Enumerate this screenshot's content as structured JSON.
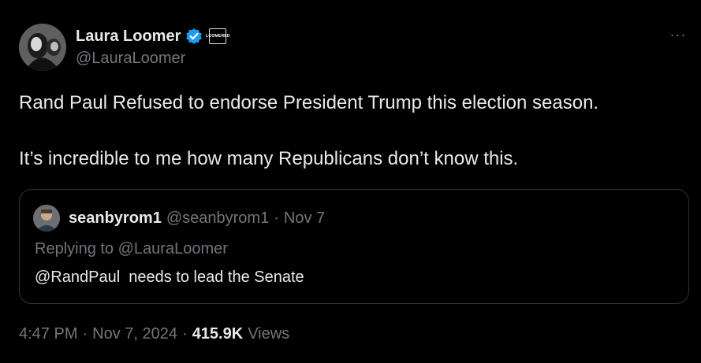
{
  "author": {
    "display_name": "Laura Loomer",
    "handle": "@LauraLoomer",
    "verified_icon": "verified-badge-icon",
    "affiliation_icon": "affiliation-badge-icon",
    "affiliation_badge_text": "LOOMERED",
    "accent_color": "#1d9bf0"
  },
  "menu": {
    "more_label": "···"
  },
  "tweet": {
    "line1": "Rand Paul Refused to endorse President Trump this election season.",
    "line2": "It’s incredible to me how many Republicans don’t know this."
  },
  "quote": {
    "display_name": "seanbyrom1",
    "handle": "@seanbyrom1",
    "separator": "·",
    "date": "Nov 7",
    "replying_prefix": "Replying to",
    "replying_handle": "@LauraLoomer",
    "text": "@RandPaul  needs to lead the Senate"
  },
  "meta": {
    "time": "4:47 PM",
    "sep1": "·",
    "date": "Nov 7, 2024",
    "sep2": "·",
    "views_count": "415.9K",
    "views_label": "Views"
  }
}
